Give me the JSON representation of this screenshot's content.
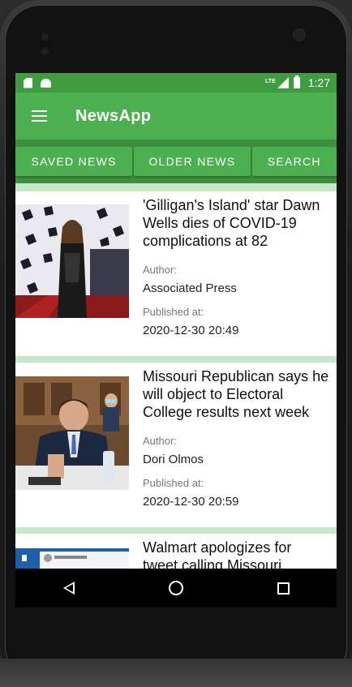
{
  "status_bar": {
    "network": "LTE",
    "time": "1:27"
  },
  "app_bar": {
    "title": "NewsApp"
  },
  "tabs": [
    {
      "label": "SAVED NEWS"
    },
    {
      "label": "OLDER NEWS"
    },
    {
      "label": "SEARCH"
    }
  ],
  "articles": [
    {
      "headline": "'Gilligan's Island' star Dawn Wells dies of COVID-19 complications at 82",
      "author_label": "Author:",
      "author": "Associated Press",
      "published_label": "Published at:",
      "published": "2020-12-30 20:49"
    },
    {
      "headline": "Missouri Republican says he will object to Electoral College results next week",
      "author_label": "Author:",
      "author": "Dori Olmos",
      "published_label": "Published at:",
      "published": "2020-12-30 20:59"
    },
    {
      "headline": "Walmart apologizes for tweet calling Missouri"
    }
  ],
  "colors": {
    "primary": "#4caf50",
    "primary_dark": "#3f9c3f",
    "list_background": "#c8e6c9"
  }
}
